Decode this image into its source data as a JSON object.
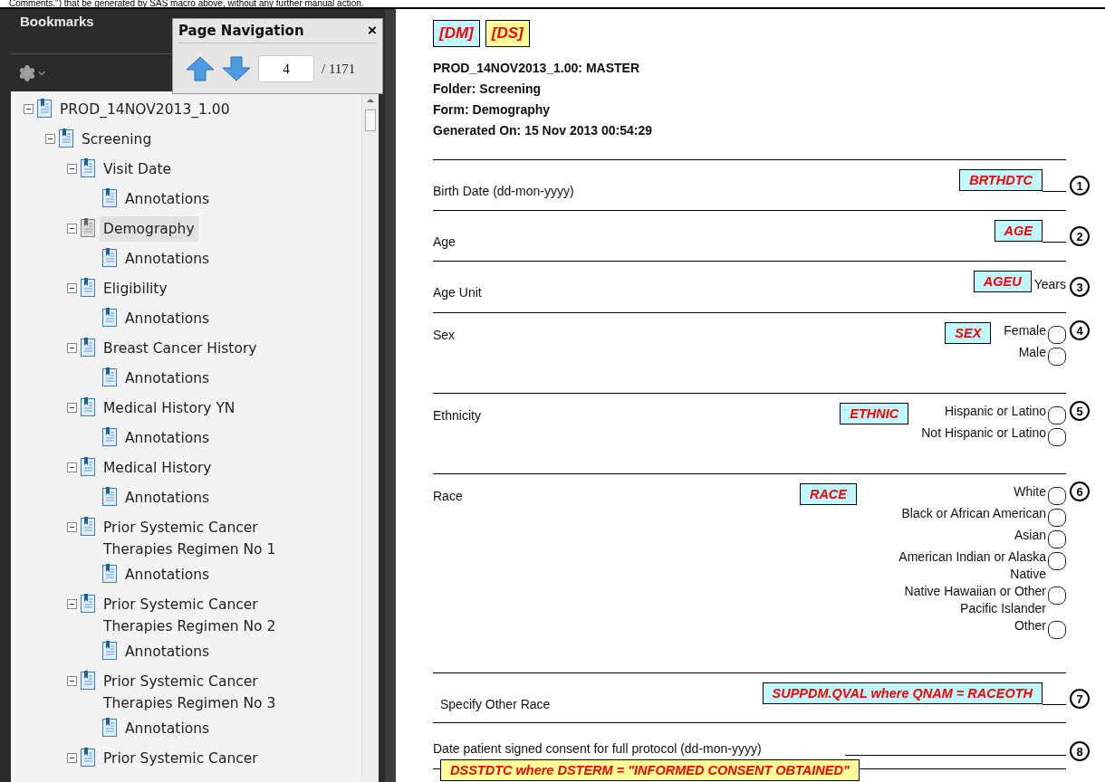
{
  "top_text": "Comments.\") that be generated by SAS macro above, without any further manual action.",
  "bookmarks": {
    "title": "Bookmarks",
    "tree": [
      {
        "label": "PROD_14NOV2013_1.00",
        "selected": false,
        "expanded": true,
        "children": [
          {
            "label": "Screening",
            "selected": false,
            "expanded": true,
            "children": [
              {
                "label": "Visit Date",
                "selected": false,
                "expanded": true,
                "children": [
                  {
                    "label": "Annotations",
                    "selected": false
                  }
                ]
              },
              {
                "label": "Demography",
                "selected": true,
                "expanded": true,
                "children": [
                  {
                    "label": "Annotations",
                    "selected": false
                  }
                ]
              },
              {
                "label": "Eligibility",
                "selected": false,
                "expanded": true,
                "children": [
                  {
                    "label": "Annotations",
                    "selected": false
                  }
                ]
              },
              {
                "label": "Breast Cancer History",
                "selected": false,
                "expanded": true,
                "children": [
                  {
                    "label": "Annotations",
                    "selected": false
                  }
                ]
              },
              {
                "label": "Medical History YN",
                "selected": false,
                "expanded": true,
                "children": [
                  {
                    "label": "Annotations",
                    "selected": false
                  }
                ]
              },
              {
                "label": "Medical History",
                "selected": false,
                "expanded": true,
                "children": [
                  {
                    "label": "Annotations",
                    "selected": false
                  }
                ]
              },
              {
                "label": "Prior Systemic Cancer Therapies Regimen No 1",
                "selected": false,
                "expanded": true,
                "children": [
                  {
                    "label": "Annotations",
                    "selected": false
                  }
                ]
              },
              {
                "label": "Prior Systemic Cancer Therapies Regimen No 2",
                "selected": false,
                "expanded": true,
                "children": [
                  {
                    "label": "Annotations",
                    "selected": false
                  }
                ]
              },
              {
                "label": "Prior Systemic Cancer Therapies Regimen No 3",
                "selected": false,
                "expanded": true,
                "children": [
                  {
                    "label": "Annotations",
                    "selected": false
                  }
                ]
              },
              {
                "label": "Prior Systemic Cancer",
                "selected": false,
                "expanded": true
              }
            ]
          }
        ]
      }
    ]
  },
  "page_navigation": {
    "title": "Page Navigation",
    "close": "×",
    "page": "4",
    "total": "/ 1171"
  },
  "document": {
    "domains": [
      {
        "text": "[DM]",
        "color": "#bff8ff"
      },
      {
        "text": "[DS]",
        "color": "#ffff99"
      }
    ],
    "meta": [
      "PROD_14NOV2013_1.00: MASTER",
      "Folder: Screening",
      "Form: Demography",
      "Generated On: 15 Nov 2013 00:54:29"
    ],
    "questions": [
      {
        "kind": "field",
        "label": "Birth Date (dd-mon-yyyy)",
        "annotation": {
          "text": "BRTHDTC",
          "color": "#bff8ff"
        },
        "number": "1"
      },
      {
        "kind": "field",
        "label": "Age",
        "annotation": {
          "text": "AGE",
          "color": "#bff8ff"
        },
        "number": "2"
      },
      {
        "kind": "unit",
        "label": "Age Unit",
        "annotation": {
          "text": "AGEU",
          "color": "#bff8ff"
        },
        "unit": "Years",
        "number": "3"
      },
      {
        "kind": "radio",
        "label": "Sex",
        "annotation": {
          "text": "SEX",
          "color": "#bff8ff"
        },
        "options": [
          {
            "label": "Female",
            "selected": false
          },
          {
            "label": "Male",
            "selected": false
          }
        ],
        "number": "4"
      },
      {
        "kind": "radio",
        "label": "Ethnicity",
        "annotation": {
          "text": "ETHNIC",
          "color": "#bff8ff"
        },
        "options": [
          {
            "label": "Hispanic or Latino",
            "selected": false
          },
          {
            "label": "Not Hispanic or Latino",
            "selected": false
          }
        ],
        "number": "5"
      },
      {
        "kind": "radio",
        "label": "Race",
        "annotation": {
          "text": "RACE",
          "color": "#bff8ff"
        },
        "options": [
          {
            "label": "White",
            "selected": false
          },
          {
            "label": "Black or African American",
            "selected": false
          },
          {
            "label": "Asian",
            "selected": false
          },
          {
            "label": "American Indian or Alaska Native",
            "selected": false
          },
          {
            "label": "Native Hawaiian or Other Pacific Islander",
            "selected": false
          },
          {
            "label": "Other",
            "selected": false
          }
        ],
        "number": "6"
      },
      {
        "kind": "field",
        "label": "Specify Other Race",
        "annotation": {
          "text": "SUPPDM.QVAL where QNAM = RACEOTH",
          "color": "#bff8ff"
        },
        "number": "7"
      },
      {
        "kind": "field_note",
        "label": "Date patient signed consent for full protocol (dd-mon-yyyy)",
        "annotation": {
          "text": "DSSTDTC where DSTERM = \"INFORMED CONSENT OBTAINED\"",
          "color": "#ffff99"
        },
        "number": "8"
      }
    ]
  }
}
